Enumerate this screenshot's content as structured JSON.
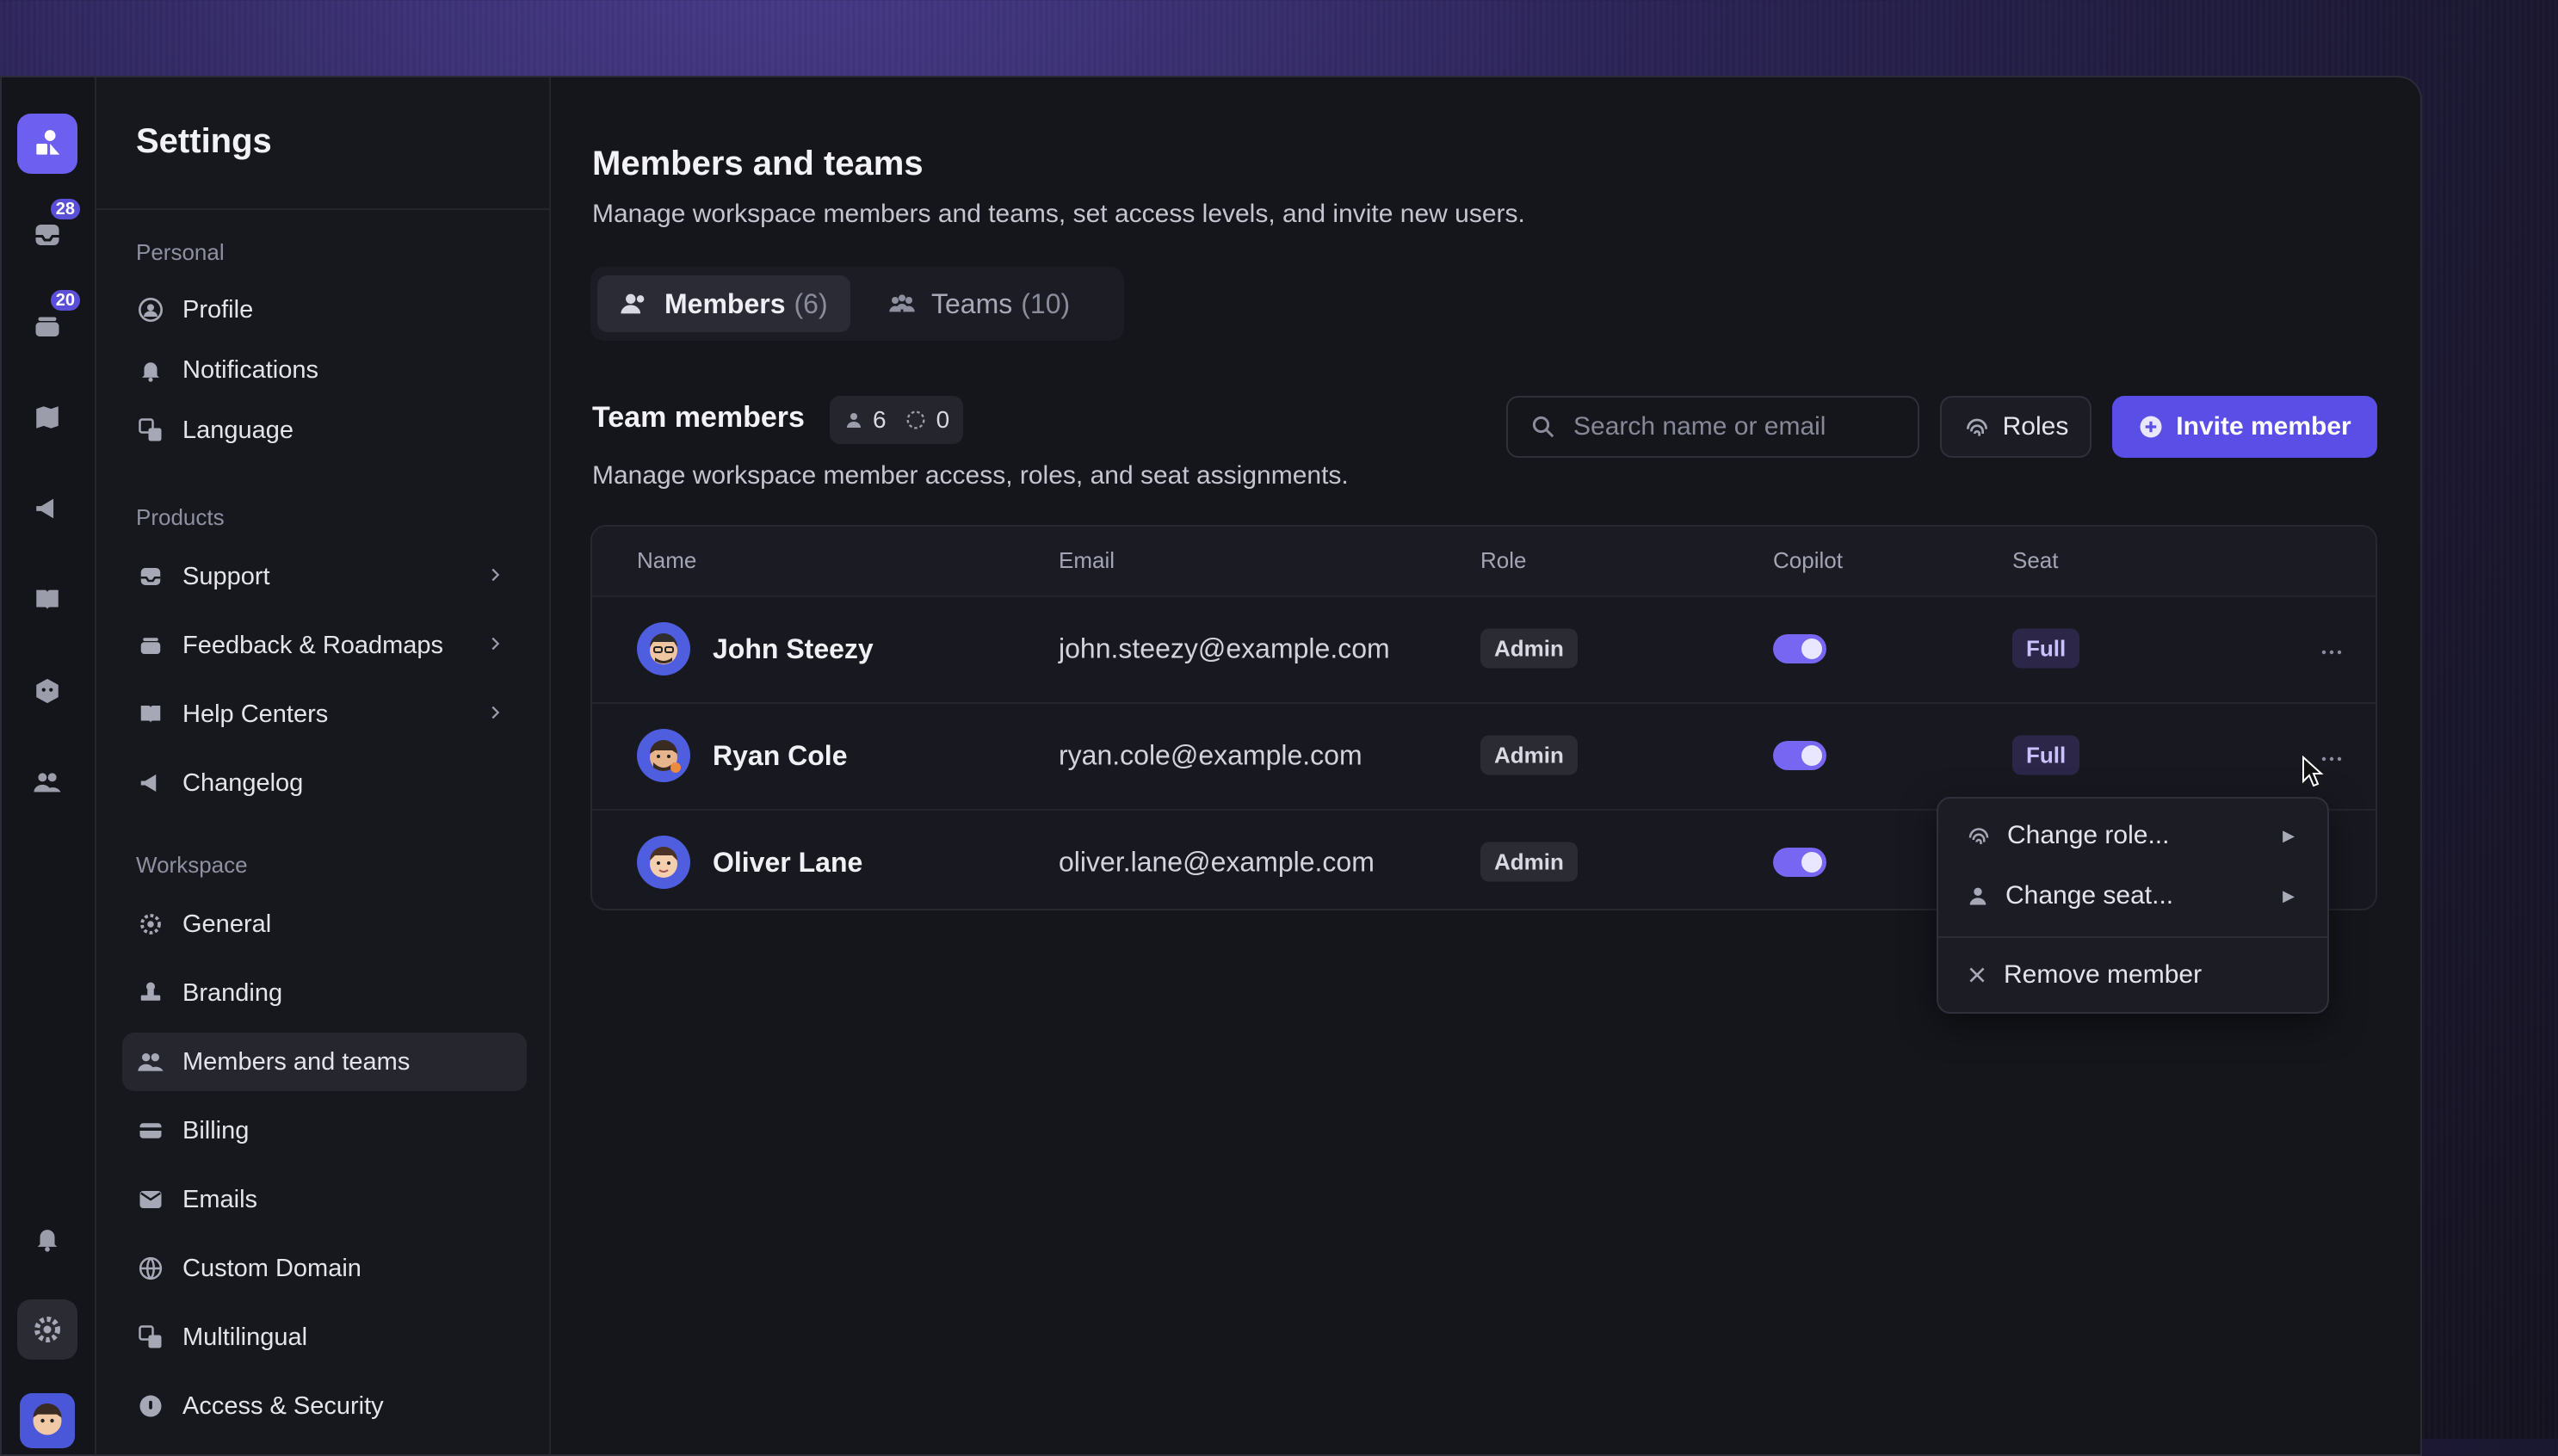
{
  "rail": {
    "badges": {
      "inbox": "28",
      "tickets": "20"
    }
  },
  "sidebar": {
    "title": "Settings",
    "sections": {
      "personal": "Personal",
      "products": "Products",
      "workspace": "Workspace"
    },
    "personal_items": [
      {
        "label": "Profile",
        "icon": "user-circle-icon"
      },
      {
        "label": "Notifications",
        "icon": "bell-icon"
      },
      {
        "label": "Language",
        "icon": "translate-icon"
      }
    ],
    "product_items": [
      {
        "label": "Support",
        "icon": "inbox-icon"
      },
      {
        "label": "Feedback & Roadmaps",
        "icon": "stack-icon"
      },
      {
        "label": "Help Centers",
        "icon": "book-icon"
      },
      {
        "label": "Changelog",
        "icon": "megaphone-icon"
      }
    ],
    "workspace_items": [
      {
        "label": "General",
        "icon": "gear-icon"
      },
      {
        "label": "Branding",
        "icon": "stamp-icon"
      },
      {
        "label": "Members and teams",
        "icon": "users-icon"
      },
      {
        "label": "Billing",
        "icon": "card-icon"
      },
      {
        "label": "Emails",
        "icon": "mail-icon"
      },
      {
        "label": "Custom Domain",
        "icon": "globe-icon"
      },
      {
        "label": "Multilingual",
        "icon": "translate-icon"
      },
      {
        "label": "Access & Security",
        "icon": "lock-icon"
      }
    ]
  },
  "main": {
    "title": "Members and teams",
    "subtitle": "Manage workspace members and teams, set access levels, and invite new users.",
    "tabs": [
      {
        "label": "Members",
        "count": "(6)"
      },
      {
        "label": "Teams",
        "count": "(10)"
      }
    ],
    "section_title": "Team members",
    "stats": {
      "members": "6",
      "pending": "0"
    },
    "section_subtitle": "Manage workspace member access, roles, and seat assignments.",
    "search_placeholder": "Search name or email",
    "roles_button": "Roles",
    "invite_button": "Invite member",
    "columns": [
      "Name",
      "Email",
      "Role",
      "Copilot",
      "Seat"
    ],
    "rows": [
      {
        "name": "John Steezy",
        "email": "john.steezy@example.com",
        "role": "Admin",
        "copilot": true,
        "seat": "Full"
      },
      {
        "name": "Ryan Cole",
        "email": "ryan.cole@example.com",
        "role": "Admin",
        "copilot": true,
        "seat": "Full"
      },
      {
        "name": "Oliver Lane",
        "email": "oliver.lane@example.com",
        "role": "Admin",
        "copilot": true,
        "seat": ""
      }
    ],
    "menu": {
      "change_role": "Change role...",
      "change_seat": "Change seat...",
      "remove": "Remove member"
    }
  },
  "colors": {
    "accent": "#5b4ee6",
    "toggle": "#7666f1",
    "background": "#15161c"
  }
}
